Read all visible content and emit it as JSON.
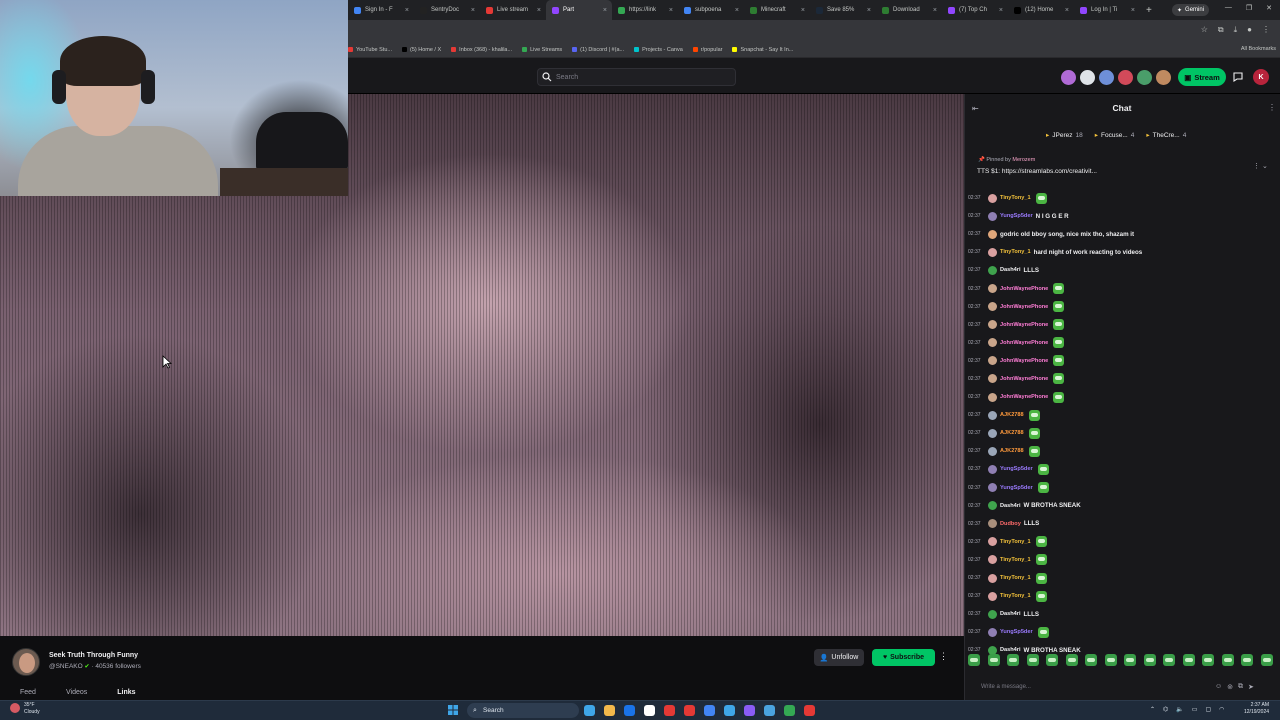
{
  "browser": {
    "tabs": [
      {
        "label": "Sign In - F",
        "color": "#4285f4",
        "active": false
      },
      {
        "label": "SentryDoc",
        "color": "#222",
        "active": false
      },
      {
        "label": "Live stream",
        "color": "#e53935",
        "active": false
      },
      {
        "label": "Part",
        "color": "#9146ff",
        "active": true
      },
      {
        "label": "https://link",
        "color": "#34a853",
        "active": false
      },
      {
        "label": "subpoena",
        "color": "#4285f4",
        "active": false
      },
      {
        "label": "Minecraft",
        "color": "#2e7d32",
        "active": false
      },
      {
        "label": "Save 85%",
        "color": "#1b2838",
        "active": false
      },
      {
        "label": "Download",
        "color": "#2e7d32",
        "active": false
      },
      {
        "label": "(7) Top Ch",
        "color": "#9146ff",
        "active": false
      },
      {
        "label": "(12) Home",
        "color": "#000",
        "active": false
      },
      {
        "label": "Log In | Ti",
        "color": "#9146ff",
        "active": false
      }
    ],
    "new_tab": "+",
    "gemini_label": "Gemini",
    "bookmarks": [
      {
        "label": "YouTube Stu...",
        "color": "#e53935"
      },
      {
        "label": "(5) Home / X",
        "color": "#000"
      },
      {
        "label": "Inbox (368) - khalila...",
        "color": "#e53935"
      },
      {
        "label": "Live Streams",
        "color": "#34a853"
      },
      {
        "label": "(1) Discord | #(a...",
        "color": "#5865f2"
      },
      {
        "label": "Projects - Canva",
        "color": "#00c4cc"
      },
      {
        "label": "r/popular",
        "color": "#ff4500"
      },
      {
        "label": "Snapchat - Say It In...",
        "color": "#fffc00"
      }
    ],
    "all_bookmarks": "All Bookmarks"
  },
  "nav": {
    "search_placeholder": "Search",
    "stream_label": "Stream",
    "user_initial": "K",
    "avatar_colors": [
      "#b06ad6",
      "#dfe3e8",
      "#6e8fd8",
      "#d24a5a",
      "#4a9e6a",
      "#c08a60"
    ]
  },
  "channel": {
    "title": "Seek Truth Through Funny",
    "handle": "@SNEAKO",
    "followers": "· 40536 followers",
    "tabs": [
      "Feed",
      "Videos",
      "Links"
    ],
    "unfollow_label": "Unfollow",
    "subscribe_label": "Subscribe"
  },
  "chat": {
    "title": "Chat",
    "leaderboard": [
      {
        "name": "JPerez",
        "count": "18"
      },
      {
        "name": "Focuse...",
        "count": "4"
      },
      {
        "name": "TheCre...",
        "count": "4"
      }
    ],
    "pinned_by": "Pinned by",
    "pinned_by_user": "Merozem",
    "pinned_message": "TTS $1: https://streamlabs.com/creativit...",
    "messages": [
      {
        "ts": "02:37",
        "user": "TinyTony_1",
        "color": "#f5c33b",
        "badge": "#d9a0a0",
        "text": "",
        "emotes": 1
      },
      {
        "ts": "02:37",
        "user": "YungSp5der",
        "color": "#9b7bff",
        "badge": "#8f7fb3",
        "text": "N I G G E R",
        "emotes": 0
      },
      {
        "ts": "02:37",
        "user": "",
        "color": "#efeff1",
        "badge": "#e0a67a",
        "text": "godric old bboy song, nice mix tho, shazam it",
        "emotes": 0
      },
      {
        "ts": "02:37",
        "user": "TinyTony_1",
        "color": "#f5c33b",
        "badge": "#d9a0a0",
        "text": "hard night of work reacting to videos",
        "emotes": 0
      },
      {
        "ts": "02:37",
        "user": "Dash4ri",
        "color": "#efeff1",
        "badge": "#3fa34d",
        "text": "LLLS",
        "emotes": 0
      },
      {
        "ts": "02:37",
        "user": "JohnWaynePhone",
        "color": "#ff7dd6",
        "badge": "#c9a58a",
        "text": "",
        "emotes": 1
      },
      {
        "ts": "02:37",
        "user": "JohnWaynePhone",
        "color": "#ff7dd6",
        "badge": "#c9a58a",
        "text": "",
        "emotes": 1
      },
      {
        "ts": "02:37",
        "user": "JohnWaynePhone",
        "color": "#ff7dd6",
        "badge": "#c9a58a",
        "text": "",
        "emotes": 1
      },
      {
        "ts": "02:37",
        "user": "JohnWaynePhone",
        "color": "#ff7dd6",
        "badge": "#c9a58a",
        "text": "",
        "emotes": 1
      },
      {
        "ts": "02:37",
        "user": "JohnWaynePhone",
        "color": "#ff7dd6",
        "badge": "#c9a58a",
        "text": "",
        "emotes": 1
      },
      {
        "ts": "02:37",
        "user": "JohnWaynePhone",
        "color": "#ff7dd6",
        "badge": "#c9a58a",
        "text": "",
        "emotes": 1
      },
      {
        "ts": "02:37",
        "user": "JohnWaynePhone",
        "color": "#ff7dd6",
        "badge": "#c9a58a",
        "text": "",
        "emotes": 1
      },
      {
        "ts": "02:37",
        "user": "AJK2788",
        "color": "#ff9a3c",
        "badge": "#9aa6b8",
        "text": "",
        "emotes": 1
      },
      {
        "ts": "02:37",
        "user": "AJK2788",
        "color": "#ff9a3c",
        "badge": "#9aa6b8",
        "text": "",
        "emotes": 1
      },
      {
        "ts": "02:37",
        "user": "AJK2788",
        "color": "#ff9a3c",
        "badge": "#9aa6b8",
        "text": "",
        "emotes": 1
      },
      {
        "ts": "02:37",
        "user": "YungSp5der",
        "color": "#9b7bff",
        "badge": "#8f7fb3",
        "text": "",
        "emotes": 1
      },
      {
        "ts": "02:37",
        "user": "YungSp5der",
        "color": "#9b7bff",
        "badge": "#8f7fb3",
        "text": "",
        "emotes": 1
      },
      {
        "ts": "02:37",
        "user": "Dash4ri",
        "color": "#efeff1",
        "badge": "#3fa34d",
        "text": "W BROTHA SNEAK",
        "emotes": 0
      },
      {
        "ts": "02:37",
        "user": "Dudboy",
        "color": "#ff6b6b",
        "badge": "#a88f7c",
        "text": "LLLS",
        "emotes": 0
      },
      {
        "ts": "02:37",
        "user": "TinyTony_1",
        "color": "#f5c33b",
        "badge": "#d9a0a0",
        "text": "",
        "emotes": 1
      },
      {
        "ts": "02:37",
        "user": "TinyTony_1",
        "color": "#f5c33b",
        "badge": "#d9a0a0",
        "text": "",
        "emotes": 1
      },
      {
        "ts": "02:37",
        "user": "TinyTony_1",
        "color": "#f5c33b",
        "badge": "#d9a0a0",
        "text": "",
        "emotes": 1
      },
      {
        "ts": "02:37",
        "user": "TinyTony_1",
        "color": "#f5c33b",
        "badge": "#d9a0a0",
        "text": "",
        "emotes": 1
      },
      {
        "ts": "02:37",
        "user": "Dash4ri",
        "color": "#efeff1",
        "badge": "#3fa34d",
        "text": "LLLS",
        "emotes": 0
      },
      {
        "ts": "02:37",
        "user": "YungSp5der",
        "color": "#9b7bff",
        "badge": "#8f7fb3",
        "text": "",
        "emotes": 1
      },
      {
        "ts": "02:37",
        "user": "Dash4ri",
        "color": "#efeff1",
        "badge": "#3fa34d",
        "text": "W BROTHA SNEAK",
        "emotes": 0
      }
    ],
    "emote_bar_count": 16,
    "input_placeholder": "Write a message..."
  },
  "taskbar": {
    "weather_temp": "35°F",
    "weather_desc": "Cloudy",
    "search_label": "Search",
    "app_colors": [
      "#3fa6e8",
      "#f2b84b",
      "#1a73e8",
      "#ffffff",
      "#e53935",
      "#e53935",
      "#4285f4",
      "#3fa6e8",
      "#8a5cf6",
      "#4aa3df",
      "#34a853",
      "#e53935"
    ],
    "time": "2:37 AM",
    "date": "12/19/2024"
  }
}
